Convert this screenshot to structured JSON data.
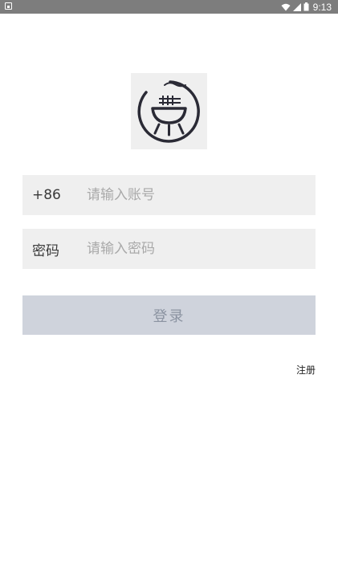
{
  "status_bar": {
    "time": "9:13",
    "icons": [
      "notification-icon",
      "wifi-icon",
      "signal-icon",
      "battery-icon"
    ]
  },
  "logo": {
    "icon": "grill-logo-icon"
  },
  "form": {
    "phone": {
      "prefix": "+86",
      "placeholder": "请输入账号",
      "value": ""
    },
    "password": {
      "label": "密码",
      "placeholder": "请输入密码",
      "value": ""
    },
    "login_label": "登录",
    "register_label": "注册"
  },
  "colors": {
    "field_bg": "#efefef",
    "button_bg": "#cfd3dc",
    "button_text": "#8b93a1",
    "logo_stroke": "#2a2a35"
  }
}
